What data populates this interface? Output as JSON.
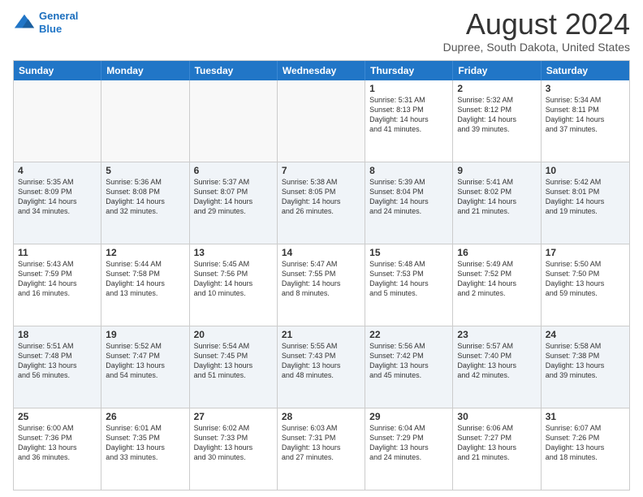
{
  "logo": {
    "line1": "General",
    "line2": "Blue"
  },
  "header": {
    "month_year": "August 2024",
    "location": "Dupree, South Dakota, United States"
  },
  "days_of_week": [
    "Sunday",
    "Monday",
    "Tuesday",
    "Wednesday",
    "Thursday",
    "Friday",
    "Saturday"
  ],
  "weeks": [
    [
      {
        "day": "",
        "detail": ""
      },
      {
        "day": "",
        "detail": ""
      },
      {
        "day": "",
        "detail": ""
      },
      {
        "day": "",
        "detail": ""
      },
      {
        "day": "1",
        "detail": "Sunrise: 5:31 AM\nSunset: 8:13 PM\nDaylight: 14 hours\nand 41 minutes."
      },
      {
        "day": "2",
        "detail": "Sunrise: 5:32 AM\nSunset: 8:12 PM\nDaylight: 14 hours\nand 39 minutes."
      },
      {
        "day": "3",
        "detail": "Sunrise: 5:34 AM\nSunset: 8:11 PM\nDaylight: 14 hours\nand 37 minutes."
      }
    ],
    [
      {
        "day": "4",
        "detail": "Sunrise: 5:35 AM\nSunset: 8:09 PM\nDaylight: 14 hours\nand 34 minutes."
      },
      {
        "day": "5",
        "detail": "Sunrise: 5:36 AM\nSunset: 8:08 PM\nDaylight: 14 hours\nand 32 minutes."
      },
      {
        "day": "6",
        "detail": "Sunrise: 5:37 AM\nSunset: 8:07 PM\nDaylight: 14 hours\nand 29 minutes."
      },
      {
        "day": "7",
        "detail": "Sunrise: 5:38 AM\nSunset: 8:05 PM\nDaylight: 14 hours\nand 26 minutes."
      },
      {
        "day": "8",
        "detail": "Sunrise: 5:39 AM\nSunset: 8:04 PM\nDaylight: 14 hours\nand 24 minutes."
      },
      {
        "day": "9",
        "detail": "Sunrise: 5:41 AM\nSunset: 8:02 PM\nDaylight: 14 hours\nand 21 minutes."
      },
      {
        "day": "10",
        "detail": "Sunrise: 5:42 AM\nSunset: 8:01 PM\nDaylight: 14 hours\nand 19 minutes."
      }
    ],
    [
      {
        "day": "11",
        "detail": "Sunrise: 5:43 AM\nSunset: 7:59 PM\nDaylight: 14 hours\nand 16 minutes."
      },
      {
        "day": "12",
        "detail": "Sunrise: 5:44 AM\nSunset: 7:58 PM\nDaylight: 14 hours\nand 13 minutes."
      },
      {
        "day": "13",
        "detail": "Sunrise: 5:45 AM\nSunset: 7:56 PM\nDaylight: 14 hours\nand 10 minutes."
      },
      {
        "day": "14",
        "detail": "Sunrise: 5:47 AM\nSunset: 7:55 PM\nDaylight: 14 hours\nand 8 minutes."
      },
      {
        "day": "15",
        "detail": "Sunrise: 5:48 AM\nSunset: 7:53 PM\nDaylight: 14 hours\nand 5 minutes."
      },
      {
        "day": "16",
        "detail": "Sunrise: 5:49 AM\nSunset: 7:52 PM\nDaylight: 14 hours\nand 2 minutes."
      },
      {
        "day": "17",
        "detail": "Sunrise: 5:50 AM\nSunset: 7:50 PM\nDaylight: 13 hours\nand 59 minutes."
      }
    ],
    [
      {
        "day": "18",
        "detail": "Sunrise: 5:51 AM\nSunset: 7:48 PM\nDaylight: 13 hours\nand 56 minutes."
      },
      {
        "day": "19",
        "detail": "Sunrise: 5:52 AM\nSunset: 7:47 PM\nDaylight: 13 hours\nand 54 minutes."
      },
      {
        "day": "20",
        "detail": "Sunrise: 5:54 AM\nSunset: 7:45 PM\nDaylight: 13 hours\nand 51 minutes."
      },
      {
        "day": "21",
        "detail": "Sunrise: 5:55 AM\nSunset: 7:43 PM\nDaylight: 13 hours\nand 48 minutes."
      },
      {
        "day": "22",
        "detail": "Sunrise: 5:56 AM\nSunset: 7:42 PM\nDaylight: 13 hours\nand 45 minutes."
      },
      {
        "day": "23",
        "detail": "Sunrise: 5:57 AM\nSunset: 7:40 PM\nDaylight: 13 hours\nand 42 minutes."
      },
      {
        "day": "24",
        "detail": "Sunrise: 5:58 AM\nSunset: 7:38 PM\nDaylight: 13 hours\nand 39 minutes."
      }
    ],
    [
      {
        "day": "25",
        "detail": "Sunrise: 6:00 AM\nSunset: 7:36 PM\nDaylight: 13 hours\nand 36 minutes."
      },
      {
        "day": "26",
        "detail": "Sunrise: 6:01 AM\nSunset: 7:35 PM\nDaylight: 13 hours\nand 33 minutes."
      },
      {
        "day": "27",
        "detail": "Sunrise: 6:02 AM\nSunset: 7:33 PM\nDaylight: 13 hours\nand 30 minutes."
      },
      {
        "day": "28",
        "detail": "Sunrise: 6:03 AM\nSunset: 7:31 PM\nDaylight: 13 hours\nand 27 minutes."
      },
      {
        "day": "29",
        "detail": "Sunrise: 6:04 AM\nSunset: 7:29 PM\nDaylight: 13 hours\nand 24 minutes."
      },
      {
        "day": "30",
        "detail": "Sunrise: 6:06 AM\nSunset: 7:27 PM\nDaylight: 13 hours\nand 21 minutes."
      },
      {
        "day": "31",
        "detail": "Sunrise: 6:07 AM\nSunset: 7:26 PM\nDaylight: 13 hours\nand 18 minutes."
      }
    ]
  ]
}
